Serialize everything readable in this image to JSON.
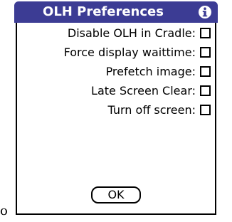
{
  "dialog": {
    "title": "OLH Preferences",
    "info_icon": "info-icon",
    "title_bar_color": "#3c3c94",
    "stray_glyph": "o",
    "preferences": [
      {
        "label": "Disable OLH in Cradle:",
        "checked": false
      },
      {
        "label": "Force display waittime:",
        "checked": false
      },
      {
        "label": "Prefetch image:",
        "checked": false
      },
      {
        "label": "Late Screen Clear:",
        "checked": false
      },
      {
        "label": "Turn off screen:",
        "checked": false
      }
    ],
    "ok_label": "OK"
  }
}
